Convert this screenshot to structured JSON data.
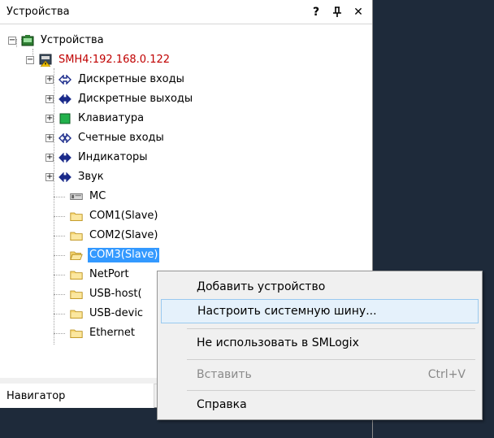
{
  "panel": {
    "title": "Устройства",
    "help_btn": "?",
    "pin_btn": "ᵩ",
    "close_btn": "✕"
  },
  "tree": {
    "root_label": "Устройства",
    "device_label": "SMH4:192.168.0.122",
    "items": [
      {
        "label": "Дискретные входы"
      },
      {
        "label": "Дискретные выходы"
      },
      {
        "label": "Клавиатура"
      },
      {
        "label": "Счетные входы"
      },
      {
        "label": "Индикаторы"
      },
      {
        "label": "Звук"
      },
      {
        "label": "MC"
      },
      {
        "label": "COM1(Slave)"
      },
      {
        "label": "COM2(Slave)"
      },
      {
        "label": "COM3(Slave)"
      },
      {
        "label": "NetPort"
      },
      {
        "label": "USB-host("
      },
      {
        "label": "USB-devic"
      },
      {
        "label": "Ethernet"
      }
    ]
  },
  "navigator": {
    "tab_label": "Навигатор"
  },
  "context_menu": {
    "items": [
      {
        "label": "Добавить устройство",
        "shortcut": ""
      },
      {
        "label": "Настроить системную шину...",
        "shortcut": ""
      },
      {
        "label": "Не использовать в SMLogix",
        "shortcut": ""
      },
      {
        "label": "Вставить",
        "shortcut": "Ctrl+V"
      },
      {
        "label": "Справка",
        "shortcut": ""
      }
    ]
  },
  "colors": {
    "device_text": "#c00000",
    "selection": "#3399ff",
    "dark_background": "#1e2a3a"
  }
}
